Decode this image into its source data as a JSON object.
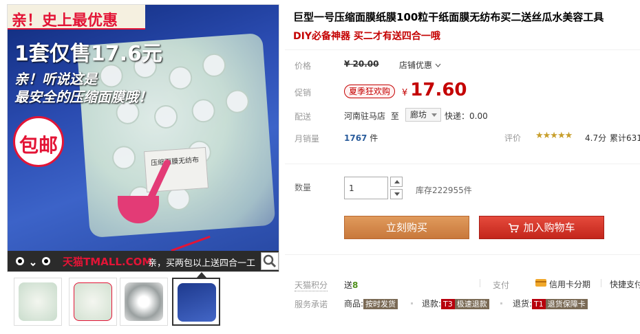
{
  "gallery": {
    "promo_banner": "亲！史上最优惠",
    "price_line": "1套仅售17.6元",
    "hear_line": "亲！听说这是",
    "safe_line": "最安全的压缩面膜哦！",
    "free_shipping": "包邮",
    "bag_label": "压缩面膜无纺布",
    "tmall_logo": "天猫TMALL.COM",
    "tmall_text": "亲，买两包以上送四合一工",
    "thumbnails": [
      {
        "label": ""
      },
      {
        "label": ""
      },
      {
        "label": ""
      },
      {
        "label": ""
      }
    ],
    "active_thumb_index": 3
  },
  "product": {
    "title": "巨型一号压缩面膜纸膜100粒干纸面膜无纺布买二送丝瓜水美容工具",
    "subtitle": "DIY必备神器 买二才有送四合一哦"
  },
  "price": {
    "label": "价格",
    "original": "¥ 20.00",
    "shop_promo": "店铺优惠",
    "promo_label": "促销",
    "promo_badge": "夏季狂欢购",
    "currency": "¥",
    "current": "17.60"
  },
  "shipping": {
    "label": "配送",
    "from": "河南驻马店",
    "to_prefix": "至",
    "to": "廊坊",
    "fee": "快递：0.00"
  },
  "sales": {
    "label": "月销量",
    "count": "1767",
    "unit": "件",
    "rating_label": "评价",
    "stars": "★★★★★",
    "rating": "4.7分",
    "total_reviews": "累计631"
  },
  "quantity": {
    "label": "数量",
    "value": "1",
    "stock": "库存222955件"
  },
  "actions": {
    "buy_now": "立刻购买",
    "add_to_cart": "加入购物车"
  },
  "extras": {
    "points_label": "天猫积分",
    "points_prefix": "送",
    "points_value": "8",
    "pay_label": "支付",
    "pay_credit": "信用卡分期",
    "pay_quick": "快捷支付",
    "service_label": "服务承诺",
    "service_goods_label": "商品:",
    "service_goods_tag": "按时发货",
    "service_refund_label": "退款:",
    "service_refund_code": "T3",
    "service_refund_tag": "极速退款",
    "service_return_label": "退货:",
    "service_return_code": "T1",
    "service_return_tag": "退货保障卡"
  },
  "colors": {
    "accent_red": "#c40000",
    "buy_button": "#d78a4e",
    "cart_button": "#d2342a",
    "tmall_red": "#e31436"
  }
}
